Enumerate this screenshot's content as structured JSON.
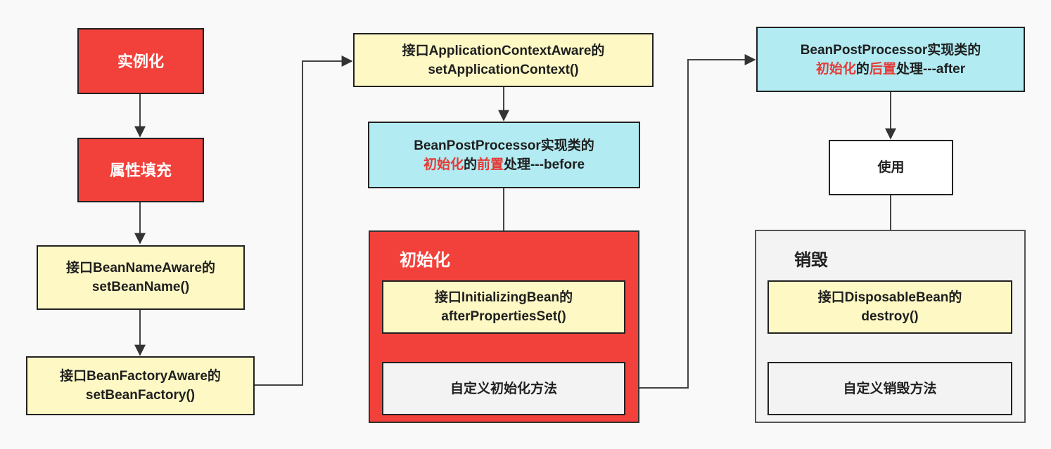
{
  "left_column": {
    "instantiate": "实例化",
    "populate": "属性填充",
    "bean_name_aware_line1": "接口BeanNameAware的",
    "bean_name_aware_line2": "setBeanName()",
    "bean_factory_aware_line1": "接口BeanFactoryAware的",
    "bean_factory_aware_line2": "setBeanFactory()"
  },
  "middle_column": {
    "app_context_aware_line1": "接口ApplicationContextAware的",
    "app_context_aware_line2": "setApplicationContext()",
    "before": {
      "line1": "BeanPostProcessor实现类的",
      "init_word": "初始化",
      "de": "的",
      "stage_word": "前置",
      "suffix": "处理---before"
    },
    "init_group_title": "初始化",
    "initializing_bean_line1": "接口InitializingBean的",
    "initializing_bean_line2": "afterPropertiesSet()",
    "custom_init": "自定义初始化方法"
  },
  "right_column": {
    "after": {
      "line1": "BeanPostProcessor实现类的",
      "init_word": "初始化",
      "de": "的",
      "stage_word": "后置",
      "suffix": "处理---after"
    },
    "use": "使用",
    "destroy_group_title": "销毁",
    "disposable_bean_line1": "接口DisposableBean的",
    "disposable_bean_line2": "destroy()",
    "custom_destroy": "自定义销毁方法"
  },
  "colors": {
    "red": "#f2413b",
    "yellow": "#fdf8c4",
    "cyan": "#b2ebf2",
    "highlight_text": "#e53935",
    "grey_group": "#f3f3f3"
  }
}
